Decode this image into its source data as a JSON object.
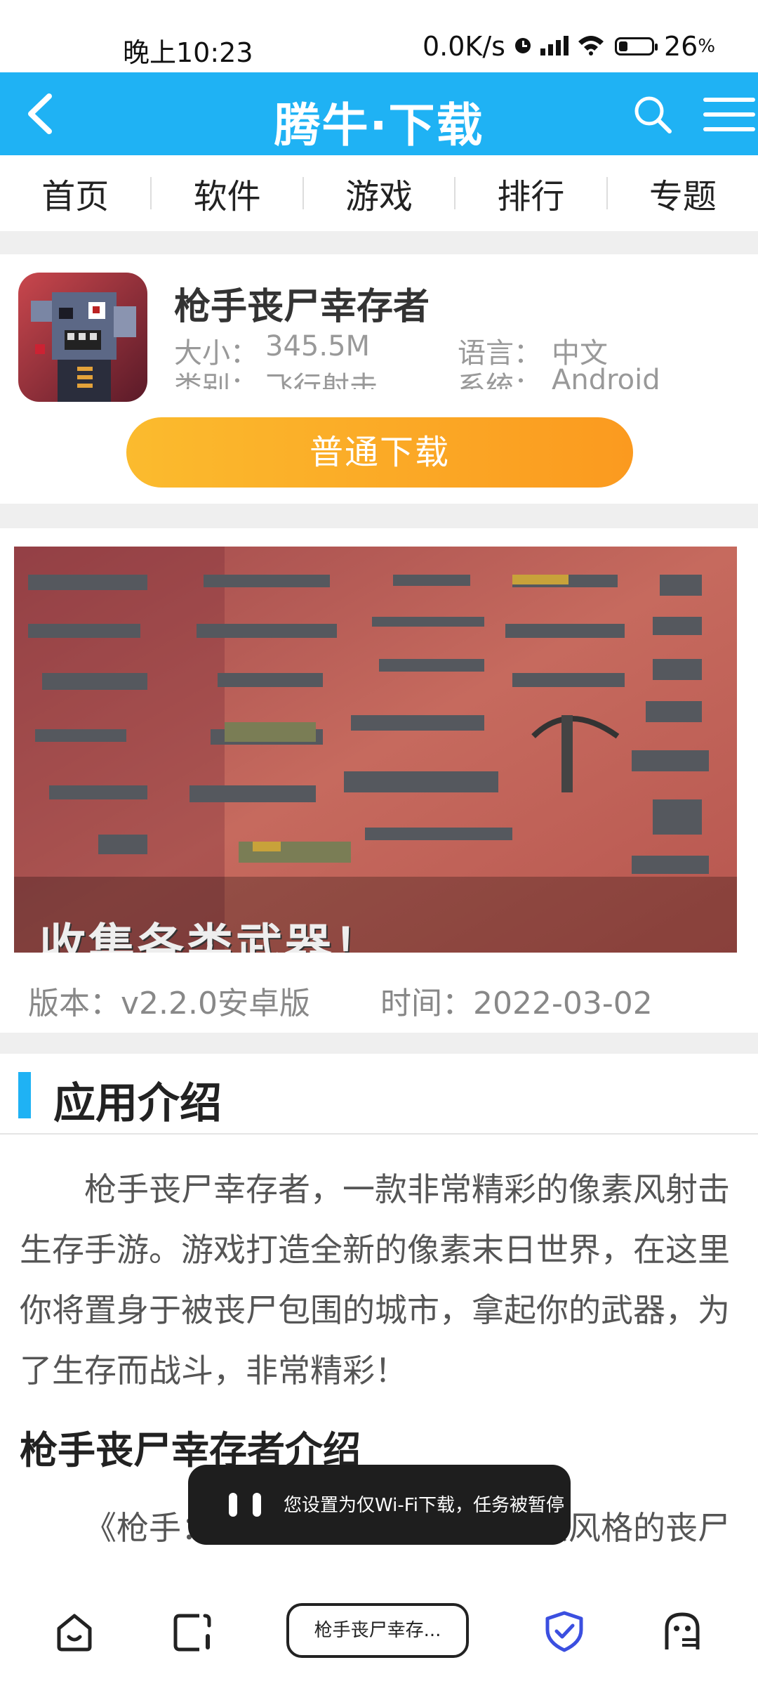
{
  "status_bar": {
    "time": "晚上10:23",
    "net_speed": "0.0K/s",
    "battery": "26",
    "battery_unit": "%",
    "icons": [
      "alarm-icon",
      "signal-icon",
      "wifi-icon",
      "battery-icon"
    ]
  },
  "header": {
    "title": "腾牛·下载",
    "bg_color": "#1fb2f4",
    "icons": [
      "back-icon",
      "search-icon",
      "menu-icon"
    ]
  },
  "nav": {
    "items": [
      "首页",
      "软件",
      "游戏",
      "排行",
      "专题"
    ]
  },
  "app": {
    "name": "枪手丧尸幸存者",
    "size_label": "大小：",
    "size": "345.5M",
    "language_label": "语言：",
    "language": "中文",
    "category_label": "类别：",
    "category": "飞行射击",
    "system_label": "系统：",
    "system": "Android",
    "download_label": "普通下载",
    "download_colors": [
      "#fbbb2e",
      "#fb9a1f"
    ]
  },
  "screenshot": {
    "caption": "收集各类武器！",
    "version": "版本：v2.2.0安卓版",
    "date": "时间：2022-03-02"
  },
  "intro": {
    "section_title": "应用介绍",
    "paragraph1": "枪手丧尸幸存者，一款非常精彩的像素风射击生存手游。游戏打造全新的像素末日世界，在这里你将置身于被丧尸包围的城市，拿起你的武器，为了生存而战斗，非常精彩！",
    "sub_title": "枪手丧尸幸存者介绍",
    "paragraph2": "《枪手：丧尸幸存者》是一款像素风格的丧尸题材射击游戏，幸存者在充满丧尸的世界隔离"
  },
  "toast": {
    "text": "您设置为仅Wi-Fi下载，任务被暂停"
  },
  "bottom_bar": {
    "tab_label": "枪手丧尸幸存...",
    "accent": "#3b4fe0",
    "icons": [
      "home-icon",
      "tabs-icon",
      "shield-icon",
      "ghost-icon"
    ]
  }
}
